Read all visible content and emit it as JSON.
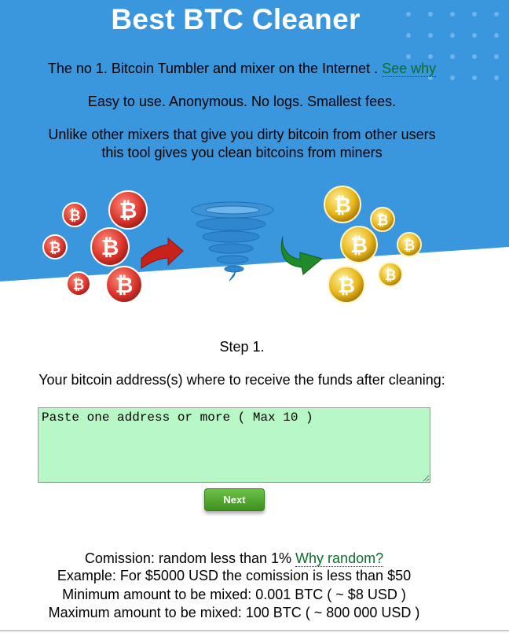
{
  "colors": {
    "hero_blue": "#3a96dd",
    "link_green": "#0b6e2a",
    "textarea_bg": "#b7f7c5",
    "button_green": "#4ea82c"
  },
  "hero": {
    "title": "Best BTC Cleaner",
    "tagline": "The no 1. Bitcoin Tumbler and mixer on the Internet .",
    "see_why": "See why",
    "features": "Easy to use. Anonymous. No logs. Smallest fees.",
    "description_line1": "Unlike other mixers that give you dirty bitcoin from other users",
    "description_line2": "this tool gives you clean bitcoins from miners"
  },
  "illustration": {
    "dirty_coins_icon": "red-bitcoin-coins",
    "arrow_in_icon": "red-arrow-icon",
    "tornado_icon": "tornado-icon",
    "arrow_out_icon": "green-arrow-icon",
    "clean_coins_icon": "gold-bitcoin-coins"
  },
  "form": {
    "step_label": "Step 1.",
    "address_label": "Your bitcoin address(s) where to receive the funds after cleaning:",
    "address_placeholder": "Paste one address or more ( Max 10 )",
    "next_label": "Next"
  },
  "info": {
    "commission": "Comission: random less than 1%",
    "why_random": "Why random?",
    "example": "Example: For $5000 USD the comission is less than $50",
    "minimum": "Minimum amount to be mixed: 0.001 BTC ( ~ $8 USD )",
    "maximum": "Maximum amount to be mixed: 100 BTC ( ~ 800 000 USD )"
  }
}
